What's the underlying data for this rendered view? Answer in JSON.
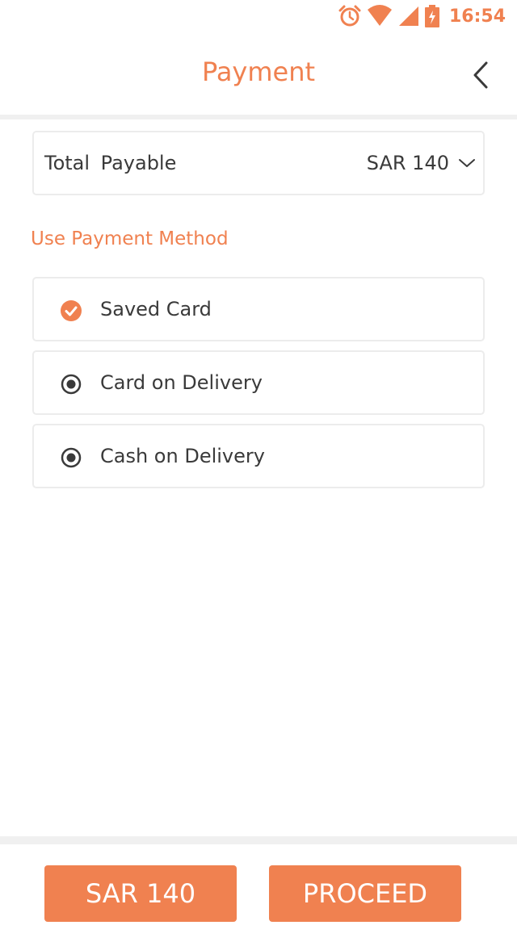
{
  "status_bar": {
    "time": "16:54",
    "icons": [
      "alarm-icon",
      "wifi-icon",
      "cell-signal-icon",
      "battery-charging-icon"
    ]
  },
  "header": {
    "title": "Payment",
    "back_icon": "chevron-left-icon"
  },
  "total": {
    "label": "Total Payable",
    "amount": "SAR 140",
    "chevron_icon": "chevron-down-icon"
  },
  "payment_section": {
    "title": "Use Payment Method",
    "options": [
      {
        "label": "Saved Card",
        "selected": true
      },
      {
        "label": "Card on Delivery",
        "selected": false
      },
      {
        "label": "Cash on Delivery",
        "selected": false
      }
    ]
  },
  "footer": {
    "amount_button": "SAR 140",
    "proceed_button": "PROCEED"
  },
  "colors": {
    "accent": "#f08150",
    "text": "#3a3a3a",
    "border": "#ececec",
    "divider": "#f0f0f0"
  }
}
